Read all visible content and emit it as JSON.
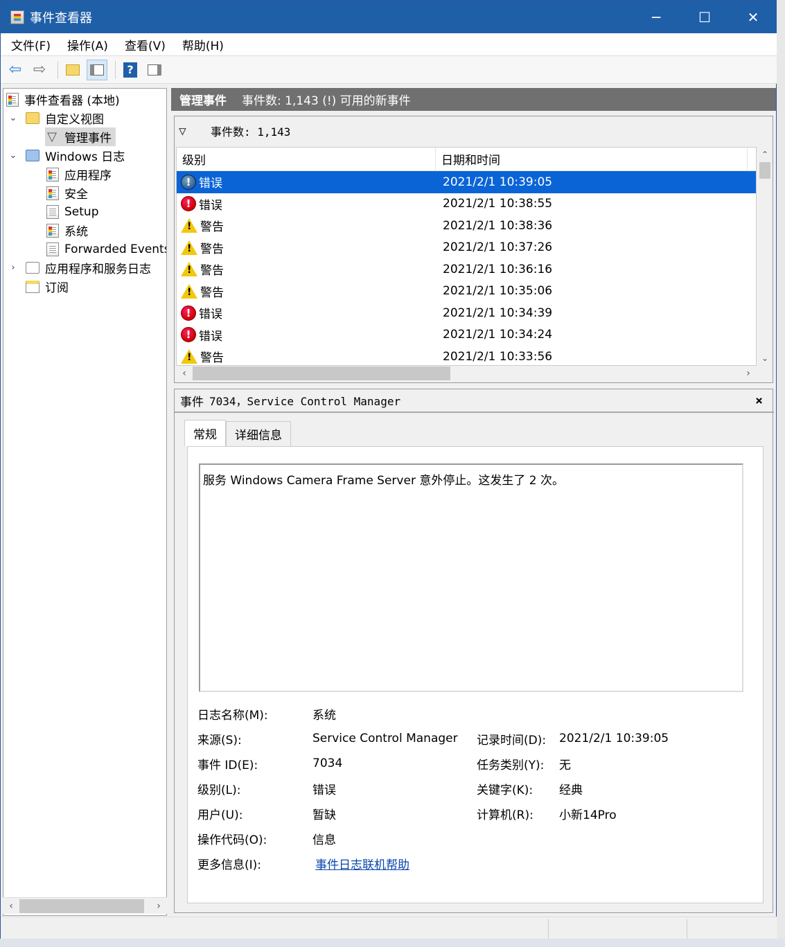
{
  "window": {
    "title": "事件查看器",
    "buttons": {
      "minimize": "─",
      "maximize": "☐",
      "close": "✕"
    }
  },
  "menu": [
    "文件(F)",
    "操作(A)",
    "查看(V)",
    "帮助(H)"
  ],
  "toolbar": {
    "back": "⇦",
    "forward": "⇨",
    "help": "?"
  },
  "tree": {
    "root": "事件查看器 (本地)",
    "custom_views": "自定义视图",
    "admin_events": "管理事件",
    "windows_logs": "Windows 日志",
    "application": "应用程序",
    "security": "安全",
    "setup": "Setup",
    "system": "系统",
    "forwarded": "Forwarded Events",
    "app_service_logs": "应用程序和服务日志",
    "subscriptions": "订阅"
  },
  "header": {
    "title": "管理事件",
    "info": "事件数: 1,143 (!) 可用的新事件"
  },
  "filter": {
    "text": "事件数: 1,143"
  },
  "table": {
    "columns": [
      "级别",
      "日期和时间"
    ],
    "rows": [
      {
        "level": "错误",
        "type": "error",
        "datetime": "2021/2/1 10:39:05",
        "selected": true
      },
      {
        "level": "错误",
        "type": "error",
        "datetime": "2021/2/1 10:38:55"
      },
      {
        "level": "警告",
        "type": "warning",
        "datetime": "2021/2/1 10:38:36"
      },
      {
        "level": "警告",
        "type": "warning",
        "datetime": "2021/2/1 10:37:26"
      },
      {
        "level": "警告",
        "type": "warning",
        "datetime": "2021/2/1 10:36:16"
      },
      {
        "level": "警告",
        "type": "warning",
        "datetime": "2021/2/1 10:35:06"
      },
      {
        "level": "错误",
        "type": "error",
        "datetime": "2021/2/1 10:34:39"
      },
      {
        "level": "错误",
        "type": "error",
        "datetime": "2021/2/1 10:34:24"
      },
      {
        "level": "警告",
        "type": "warning",
        "datetime": "2021/2/1 10:33:56"
      }
    ]
  },
  "detail": {
    "title_label": "事件",
    "title_value": "7034，Service Control Manager",
    "close": "×",
    "tabs": [
      "常规",
      "详细信息"
    ],
    "description": "服务 Windows Camera Frame Server 意外停止。这发生了 2 次。",
    "fields": {
      "log_name_label": "日志名称(M):",
      "log_name": "系统",
      "source_label": "来源(S):",
      "source": "Service Control Manager",
      "logged_label": "记录时间(D):",
      "logged": "2021/2/1 10:39:05",
      "event_id_label": "事件 ID(E):",
      "event_id": "7034",
      "task_label": "任务类别(Y):",
      "task": "无",
      "level_label": "级别(L):",
      "level": "错误",
      "keywords_label": "关键字(K):",
      "keywords": "经典",
      "user_label": "用户(U):",
      "user": "暂缺",
      "computer_label": "计算机(R):",
      "computer": "小新14Pro",
      "opcode_label": "操作代码(O):",
      "opcode": "信息",
      "more_info_label": "更多信息(I):",
      "more_info": "事件日志联机帮助"
    }
  },
  "colors": {
    "titlebar": "#1f5fa8",
    "selection": "#0a64d6",
    "header_bar": "#707070"
  }
}
